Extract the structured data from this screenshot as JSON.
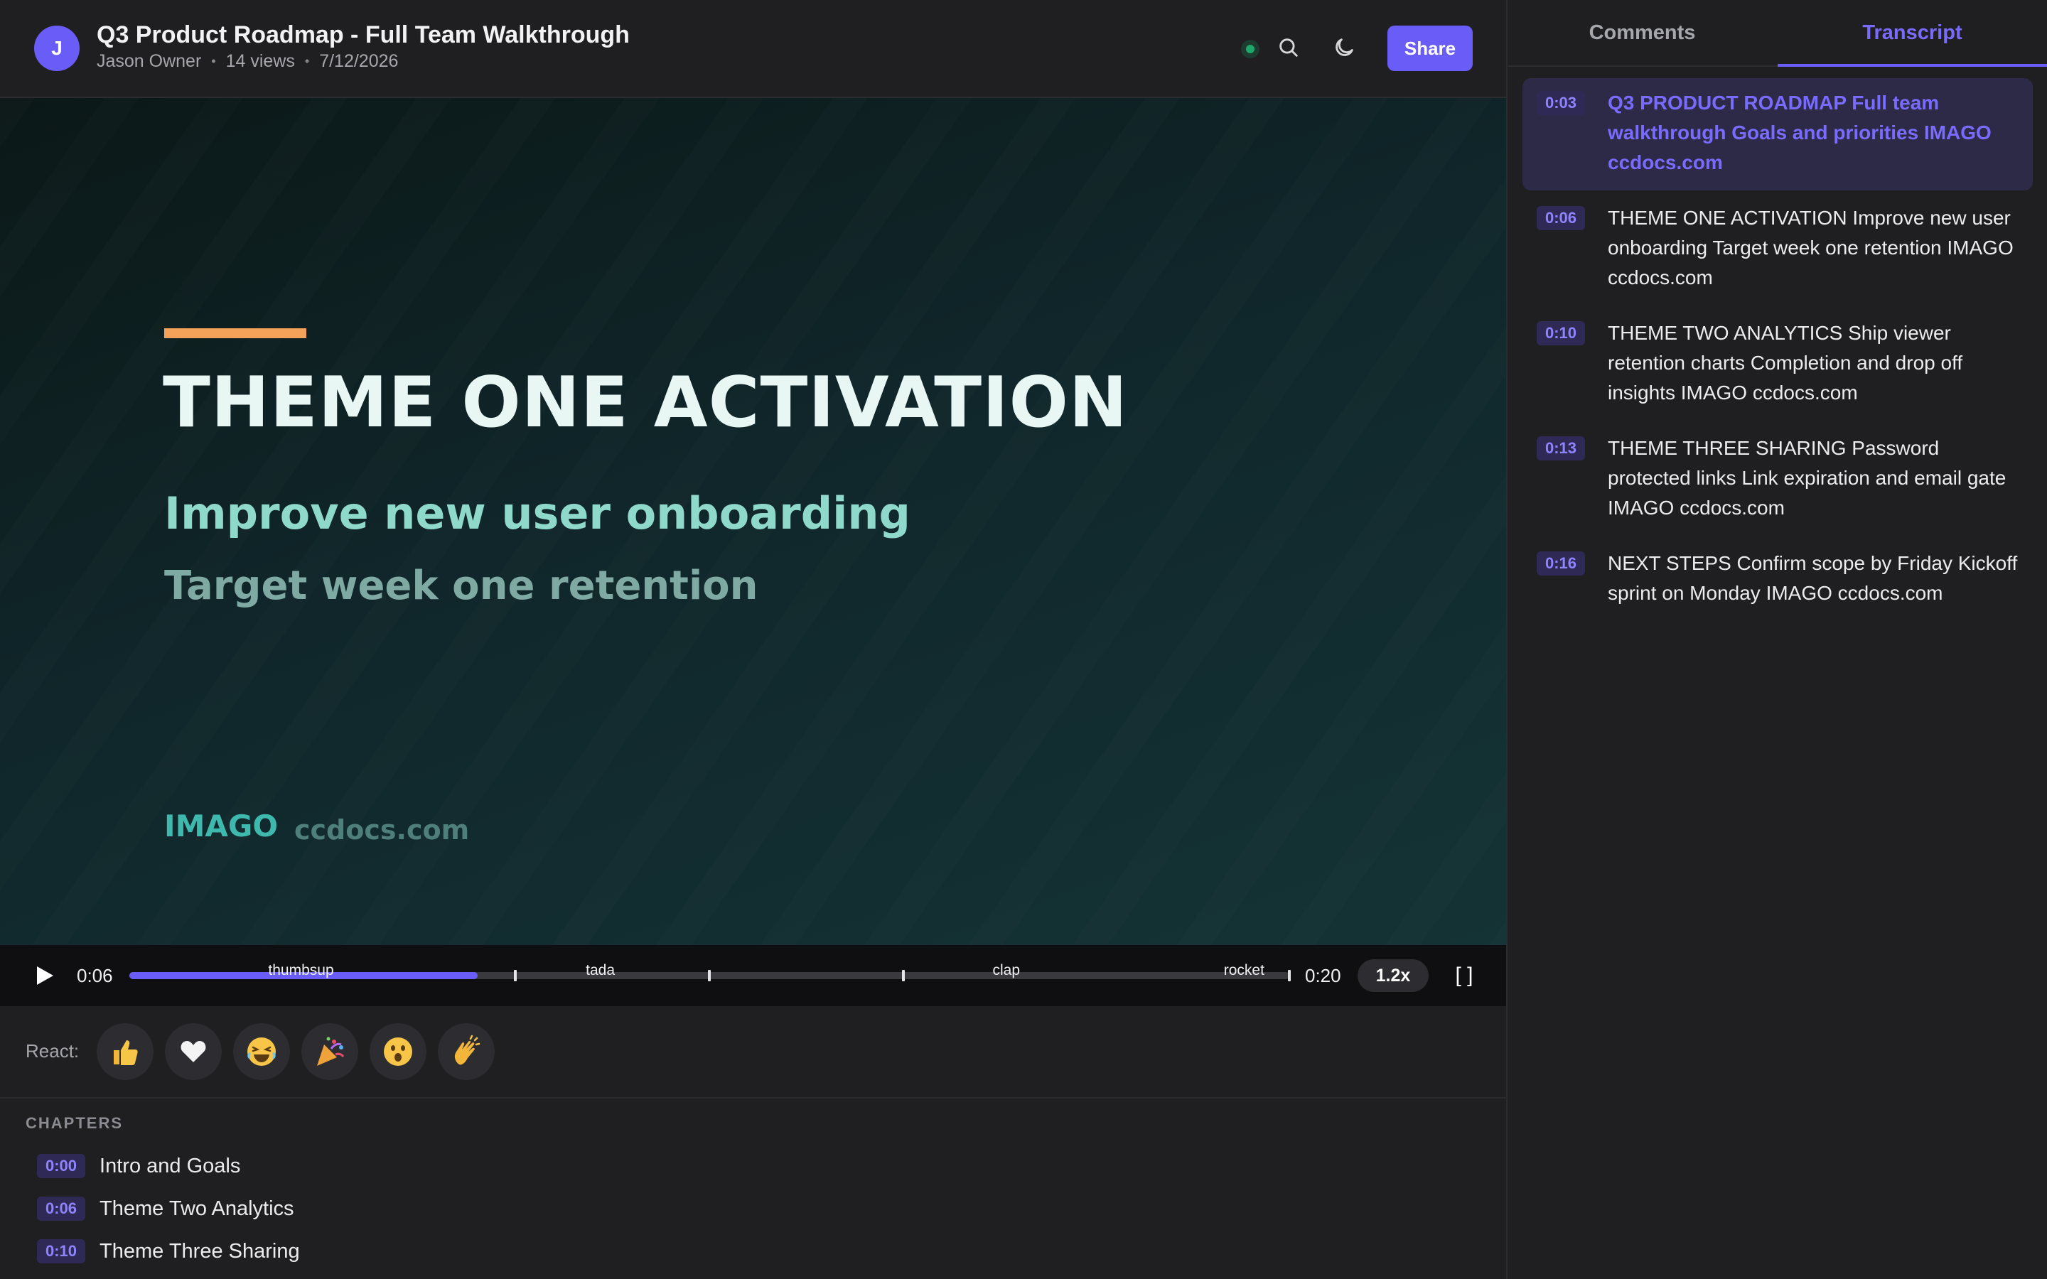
{
  "header": {
    "avatar_initial": "J",
    "title": "Q3 Product Roadmap - Full Team Walkthrough",
    "owner": "Jason Owner",
    "views": "14 views",
    "date": "7/12/2026",
    "share_label": "Share"
  },
  "slide": {
    "title": "THEME ONE ACTIVATION",
    "subtitle1": "Improve new user onboarding",
    "subtitle2": "Target week one retention",
    "brand": "IMAGO",
    "domain": "ccdocs.com"
  },
  "player": {
    "current_time": "0:06",
    "total_time": "0:20",
    "progress_fraction": 0.3,
    "speed": "1.2x",
    "fullscreen_label": "[ ]",
    "markers": [
      {
        "label": "thumbsup",
        "fraction": 0.148
      },
      {
        "label": "tada",
        "fraction": 0.406
      },
      {
        "label": "clap",
        "fraction": 0.756
      },
      {
        "label": "rocket",
        "fraction": 0.961
      }
    ],
    "ticks": [
      0.333,
      0.5,
      0.667,
      1.0
    ]
  },
  "react": {
    "label": "React:",
    "emojis": [
      "thumbs-up",
      "heart",
      "laughing",
      "party-popper",
      "surprised",
      "clapping"
    ]
  },
  "chapters": {
    "heading": "CHAPTERS",
    "items": [
      {
        "time": "0:00",
        "title": "Intro and Goals"
      },
      {
        "time": "0:06",
        "title": "Theme Two Analytics"
      },
      {
        "time": "0:10",
        "title": "Theme Three Sharing"
      }
    ]
  },
  "panel": {
    "tabs": [
      "Comments",
      "Transcript"
    ],
    "active_tab": "Transcript",
    "transcript": [
      {
        "time": "0:03",
        "text": "Q3 PRODUCT ROADMAP Full team walkthrough Goals and priorities IMAGO ccdocs.com",
        "active": true
      },
      {
        "time": "0:06",
        "text": "THEME ONE ACTIVATION Improve new user onboarding Target week one retention IMAGO ccdocs.com",
        "active": false
      },
      {
        "time": "0:10",
        "text": "THEME TWO ANALYTICS Ship viewer retention charts Completion and drop off insights IMAGO ccdocs.com",
        "active": false
      },
      {
        "time": "0:13",
        "text": "THEME THREE SHARING Password protected links Link expiration and email gate IMAGO ccdocs.com",
        "active": false
      },
      {
        "time": "0:16",
        "text": "NEXT STEPS Confirm scope by Friday Kickoff sprint on Monday IMAGO ccdocs.com",
        "active": false
      }
    ]
  },
  "colors": {
    "accent": "#6a5cf6",
    "slide_accent_bar": "#f4a259",
    "status_online": "#1fa66a"
  }
}
